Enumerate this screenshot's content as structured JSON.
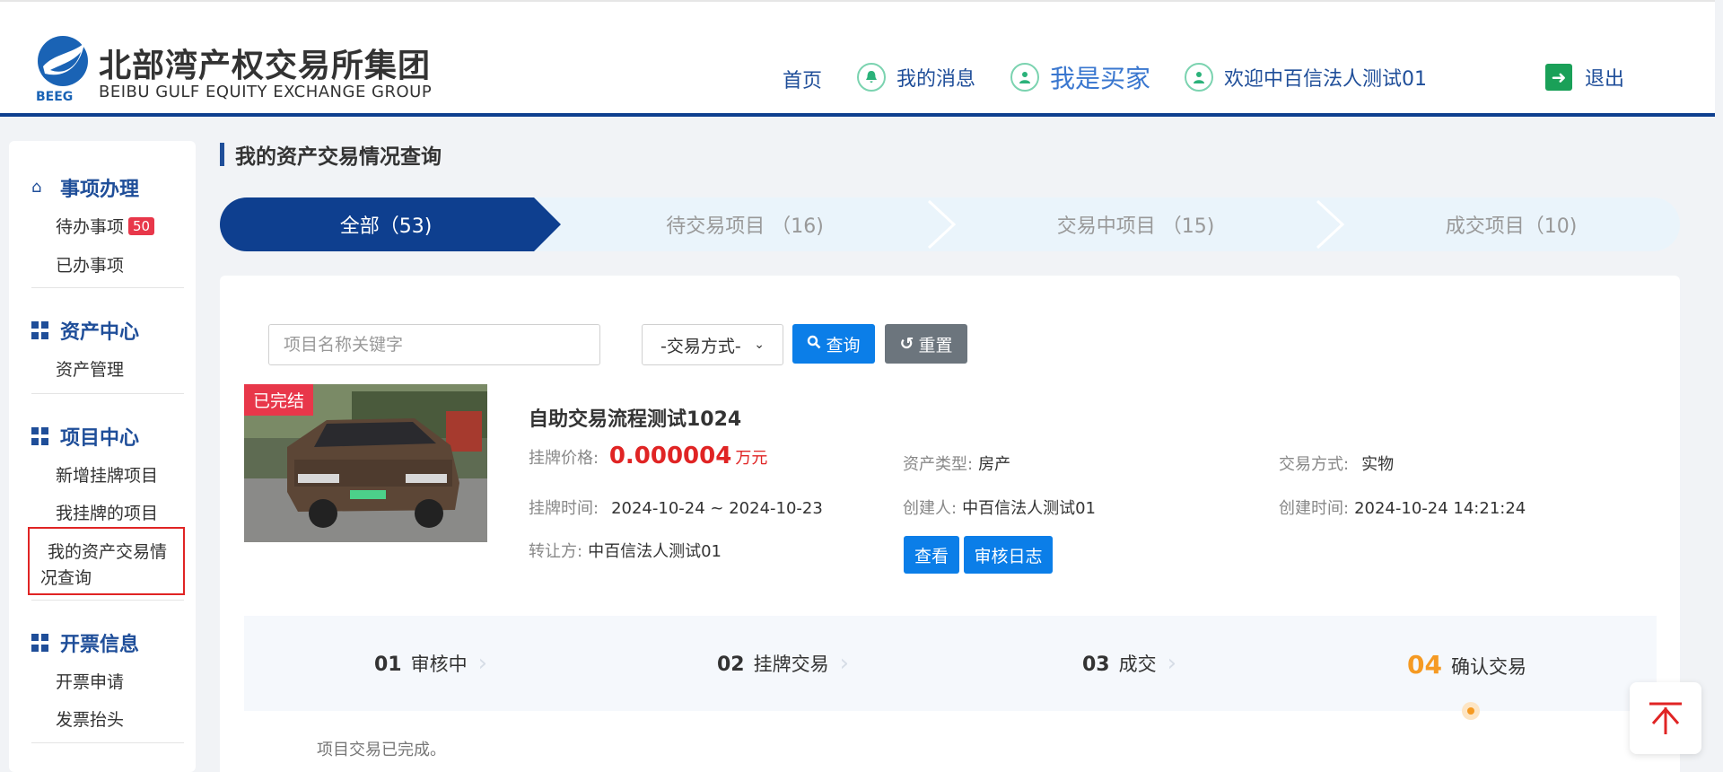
{
  "header": {
    "logo_cn": "北部湾产权交易所集团",
    "logo_en": "BEIBU GULF EQUITY EXCHANGE GROUP",
    "logo_abbr": "BEEG",
    "nav": {
      "home": "首页",
      "messages": "我的消息",
      "buyer": "我是买家",
      "welcome": "欢迎中百信法人测试01",
      "logout": "退出"
    }
  },
  "sidebar": {
    "groups": [
      {
        "title": "事项办理",
        "icon": "home-icon",
        "items": [
          {
            "label": "待办事项",
            "badge": "50"
          },
          {
            "label": "已办事项"
          }
        ]
      },
      {
        "title": "资产中心",
        "icon": "grid-icon",
        "items": [
          {
            "label": "资产管理"
          }
        ]
      },
      {
        "title": "项目中心",
        "icon": "grid-icon",
        "items": [
          {
            "label": "新增挂牌项目"
          },
          {
            "label": "我挂牌的项目"
          }
        ],
        "active_item_line1": "我的资产交易情",
        "active_item_line2": "况查询"
      },
      {
        "title": "开票信息",
        "icon": "grid-icon",
        "items": [
          {
            "label": "开票申请"
          },
          {
            "label": "发票抬头"
          }
        ]
      }
    ]
  },
  "main": {
    "page_title": "我的资产交易情况查询",
    "tabs": [
      {
        "label": "全部（53)",
        "active": true
      },
      {
        "label": "待交易项目 （16)"
      },
      {
        "label": "交易中项目 （15)"
      },
      {
        "label": "成交项目（10)"
      }
    ],
    "search": {
      "placeholder": "项目名称关键字",
      "select_value": "-交易方式-",
      "query_label": "查询",
      "reset_label": "重置"
    },
    "project": {
      "status_tag": "已完结",
      "title": "自助交易流程测试1024",
      "price_label": "挂牌价格:",
      "price_value": "0.000004",
      "price_unit": "万元",
      "asset_type_label": "资产类型:",
      "asset_type_value": "房产",
      "trade_mode_label": "交易方式:",
      "trade_mode_value": "实物",
      "list_time_label": "挂牌时间:",
      "list_time_value": "2024-10-24 ~ 2024-10-23",
      "creator_label": "创建人:",
      "creator_value": "中百信法人测试01",
      "create_time_label": "创建时间:",
      "create_time_value": "2024-10-24 14:21:24",
      "transferor_label": "转让方:",
      "transferor_value": "中百信法人测试01",
      "view_label": "查看",
      "audit_log_label": "审核日志"
    },
    "steps": [
      {
        "num": "01",
        "label": "审核中"
      },
      {
        "num": "02",
        "label": "挂牌交易"
      },
      {
        "num": "03",
        "label": "成交"
      },
      {
        "num": "04",
        "label": "确认交易",
        "active": true
      }
    ],
    "complete_text": "项目交易已完成。"
  },
  "colors": {
    "brand_blue": "#1f4e99",
    "tab_active": "#0e3f8f",
    "tab_inactive": "#eaf4fb",
    "button_blue": "#0b7ee8",
    "button_gray": "#6c757d",
    "price_red": "#e02424",
    "step_active": "#f59a23"
  }
}
